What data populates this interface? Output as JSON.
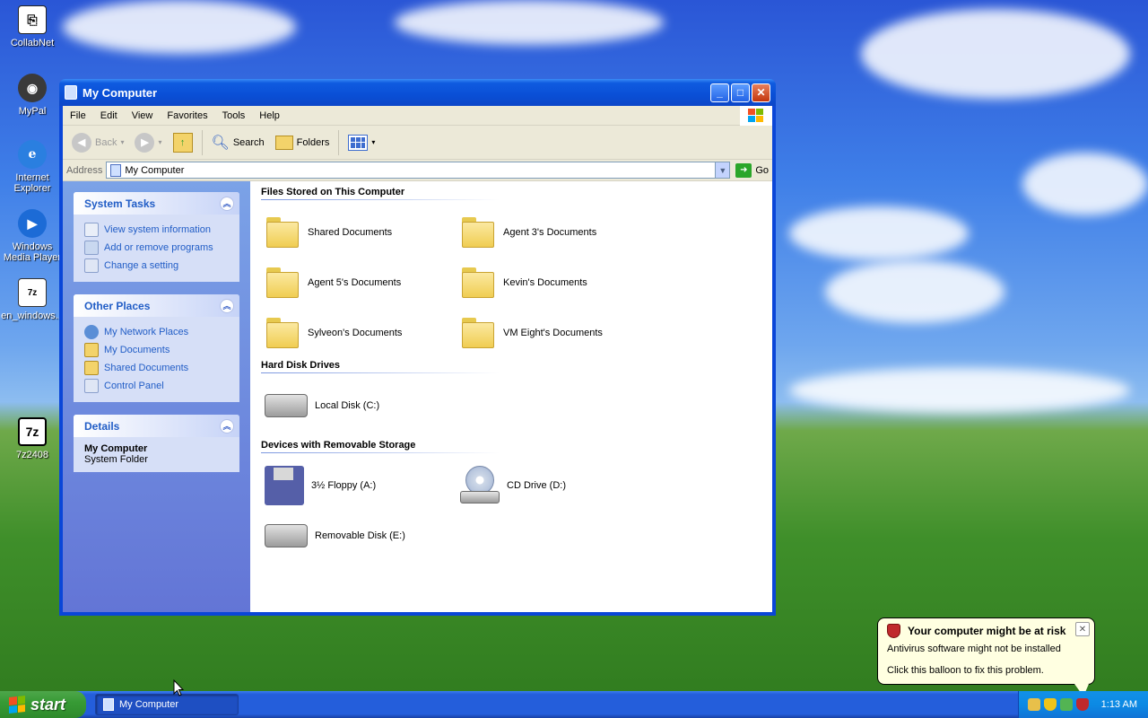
{
  "desktop": {
    "icons": [
      {
        "label": "CollabNet",
        "icon": "collabnet-icon"
      },
      {
        "label": "MyPal",
        "icon": "mypal-icon"
      },
      {
        "label": "Internet Explorer",
        "icon": "internet-explorer-icon"
      },
      {
        "label": "Windows Media Player",
        "icon": "media-player-icon"
      },
      {
        "label": "en_windows...",
        "icon": "7z-file-icon"
      },
      {
        "label": "7z2408",
        "icon": "7z-icon"
      }
    ]
  },
  "window": {
    "title": "My Computer",
    "controls": {
      "minimize": "_",
      "maximize": "□",
      "close": "✕"
    },
    "menu": [
      "File",
      "Edit",
      "View",
      "Favorites",
      "Tools",
      "Help"
    ],
    "toolbar": {
      "back_label": "Back",
      "search_label": "Search",
      "folders_label": "Folders"
    },
    "address": {
      "label": "Address",
      "value": "My Computer",
      "go_label": "Go"
    },
    "sidebar": {
      "system_tasks": {
        "title": "System Tasks",
        "items": [
          "View system information",
          "Add or remove programs",
          "Change a setting"
        ]
      },
      "other_places": {
        "title": "Other Places",
        "items": [
          "My Network Places",
          "My Documents",
          "Shared Documents",
          "Control Panel"
        ]
      },
      "details": {
        "title": "Details",
        "name": "My Computer",
        "type": "System Folder"
      }
    },
    "main": {
      "groups": [
        {
          "title": "Files Stored on This Computer",
          "items": [
            "Shared Documents",
            "Agent 3's Documents",
            "Agent 5's Documents",
            "Kevin's Documents",
            "Sylveon's Documents",
            "VM Eight's Documents"
          ]
        },
        {
          "title": "Hard Disk Drives",
          "items": [
            "Local Disk (C:)"
          ]
        },
        {
          "title": "Devices with Removable Storage",
          "items": [
            "3½ Floppy (A:)",
            "CD Drive (D:)",
            "Removable Disk (E:)"
          ]
        }
      ]
    }
  },
  "balloon": {
    "title": "Your computer might be at risk",
    "line1": "Antivirus software might not be installed",
    "line2": "Click this balloon to fix this problem."
  },
  "taskbar": {
    "start_label": "start",
    "task_label": "My Computer",
    "clock": "1:13 AM"
  },
  "colors": {
    "titlebar": "#0a4fd6",
    "sidebar_link": "#215dc6",
    "taskbar": "#245edb",
    "start_green": "#379b35"
  }
}
